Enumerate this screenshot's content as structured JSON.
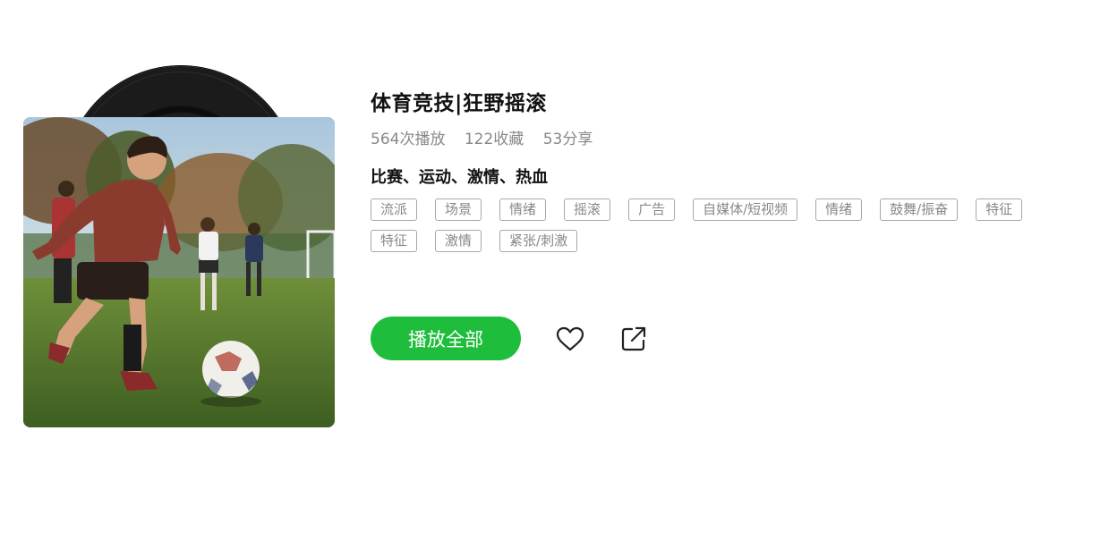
{
  "playlist": {
    "title": "体育竞技|狂野摇滚",
    "stats": {
      "plays": "564次播放",
      "favorites": "122收藏",
      "shares": "53分享"
    },
    "keywords": "比赛、运动、激情、热血",
    "tags": [
      "流派",
      "场景",
      "情绪",
      "摇滚",
      "广告",
      "自媒体/短视频",
      "情绪",
      "鼓舞/振奋",
      "特征",
      "特征",
      "激情",
      "紧张/刺激"
    ]
  },
  "actions": {
    "play_all_label": "播放全部",
    "favorite_icon": "heart-icon",
    "share_icon": "share-icon"
  },
  "colors": {
    "accent": "#1ebd3c",
    "tag_border": "#a7a7a7",
    "muted_text": "#888888"
  }
}
